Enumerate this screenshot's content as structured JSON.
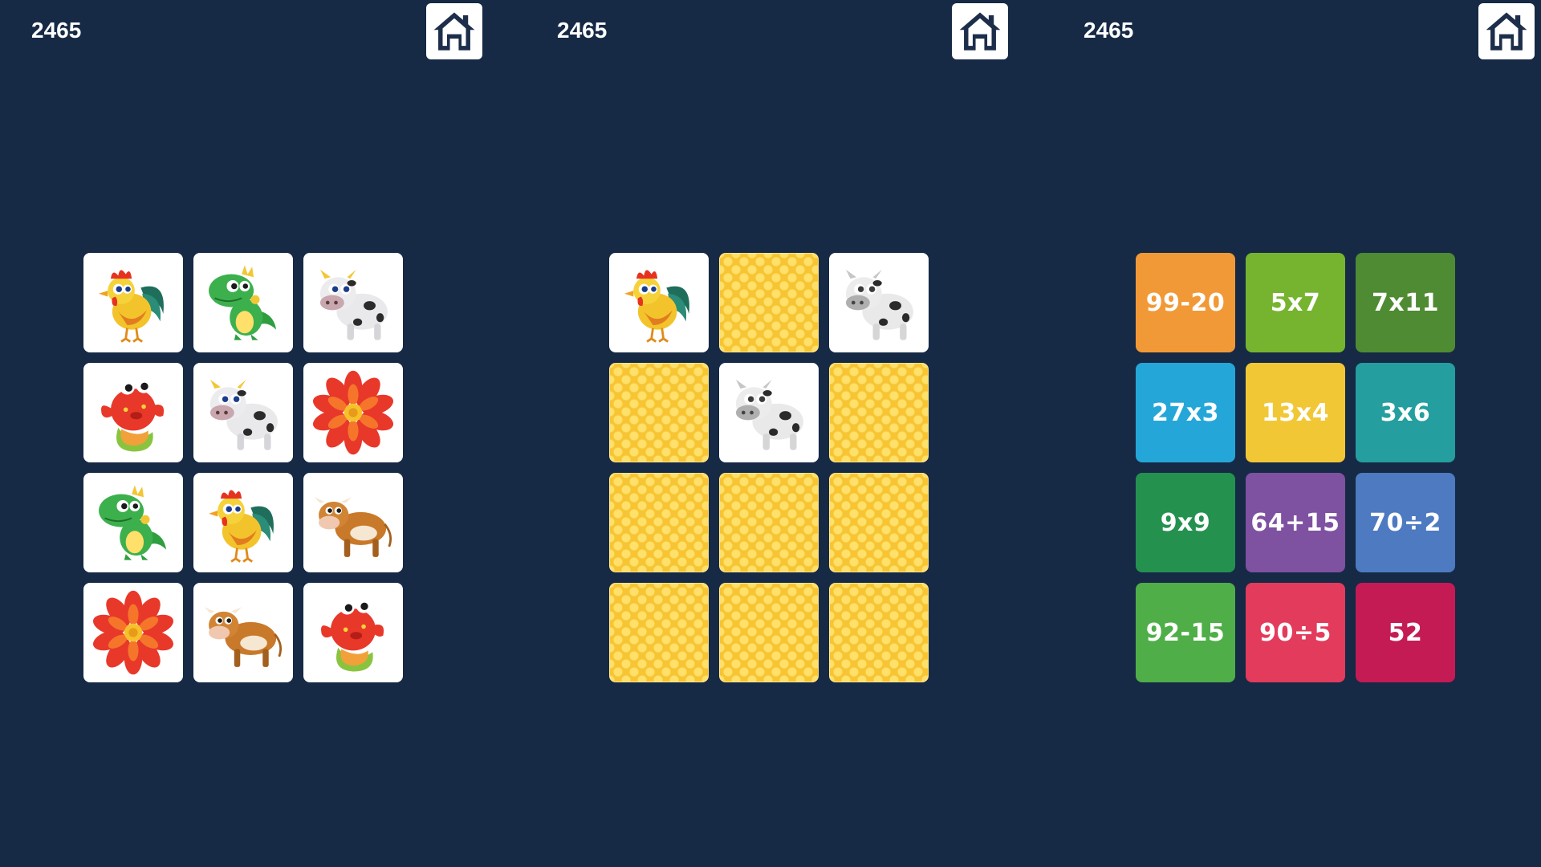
{
  "panels": [
    {
      "score": "2465",
      "home_icon": "home-icon",
      "cards": [
        {
          "face": "rooster"
        },
        {
          "face": "dinosaur"
        },
        {
          "face": "spotted-cow"
        },
        {
          "face": "red-fish"
        },
        {
          "face": "spotted-cow"
        },
        {
          "face": "red-flower"
        },
        {
          "face": "dinosaur"
        },
        {
          "face": "rooster"
        },
        {
          "face": "brown-cow"
        },
        {
          "face": "red-flower"
        },
        {
          "face": "brown-cow"
        },
        {
          "face": "red-fish"
        }
      ]
    },
    {
      "score": "2465",
      "home_icon": "home-icon",
      "cards": [
        {
          "face": "rooster",
          "state": "revealed"
        },
        {
          "face": "card-back",
          "state": "hidden"
        },
        {
          "face": "spotted-cow",
          "state": "revealed-gray"
        },
        {
          "face": "card-back",
          "state": "hidden"
        },
        {
          "face": "spotted-cow",
          "state": "revealed-gray"
        },
        {
          "face": "card-back",
          "state": "hidden"
        },
        {
          "face": "card-back",
          "state": "hidden"
        },
        {
          "face": "card-back",
          "state": "hidden"
        },
        {
          "face": "card-back",
          "state": "hidden"
        },
        {
          "face": "card-back",
          "state": "hidden"
        },
        {
          "face": "card-back",
          "state": "hidden"
        },
        {
          "face": "card-back",
          "state": "hidden"
        }
      ]
    },
    {
      "score": "2465",
      "home_icon": "home-icon",
      "tiles": [
        {
          "label": "99-20",
          "color": "#f19936"
        },
        {
          "label": "5x7",
          "color": "#76b42f"
        },
        {
          "label": "7x11",
          "color": "#4f8b32"
        },
        {
          "label": "27x3",
          "color": "#24a7d8"
        },
        {
          "label": "13x4",
          "color": "#f2c736"
        },
        {
          "label": "3x6",
          "color": "#249e9f"
        },
        {
          "label": "9x9",
          "color": "#24914f"
        },
        {
          "label": "64+15",
          "color": "#7f51a1"
        },
        {
          "label": "70÷2",
          "color": "#4d7ac1"
        },
        {
          "label": "92-15",
          "color": "#4fae48"
        },
        {
          "label": "90÷5",
          "color": "#e33b5c"
        },
        {
          "label": "52",
          "color": "#c41b55"
        }
      ]
    }
  ],
  "colors": {
    "background": "#162945",
    "card_face": "#ffffff",
    "card_back": "#f7c534"
  }
}
